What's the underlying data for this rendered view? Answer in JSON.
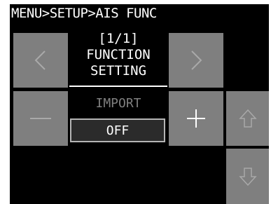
{
  "header": {
    "breadcrumb": "MENU>SETUP>AIS FUNC"
  },
  "page": {
    "indicator": "[1/1]",
    "title_line1": "FUNCTION",
    "title_line2": "SETTING"
  },
  "setting": {
    "label": "IMPORT",
    "value": "OFF"
  },
  "icons": {
    "prev": "chevron-left-icon",
    "next": "chevron-right-icon",
    "decrease": "minus-icon",
    "increase": "plus-icon",
    "scroll_up": "arrow-up-icon",
    "scroll_down": "arrow-down-icon"
  },
  "colors": {
    "background": "#000000",
    "tile": "#7f7f7f",
    "text": "#ffffff",
    "disabled_text": "#7f7f7f"
  }
}
